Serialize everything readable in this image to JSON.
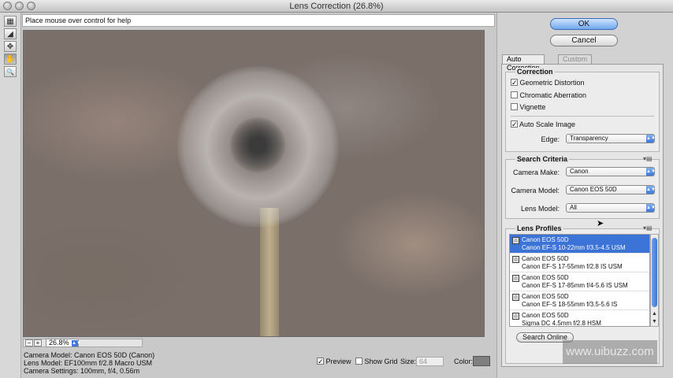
{
  "window": {
    "title": "Lens Correction (26.8%)"
  },
  "tools": [
    {
      "name": "remove-distortion-tool-icon",
      "glyph": "▦"
    },
    {
      "name": "straighten-tool-icon",
      "glyph": "◢"
    },
    {
      "name": "move-grid-tool-icon",
      "glyph": "✥"
    },
    {
      "name": "hand-tool-icon",
      "glyph": "✋"
    },
    {
      "name": "zoom-tool-icon",
      "glyph": "🔍"
    }
  ],
  "hint": "Place mouse over control for help",
  "zoom": {
    "value": "26.8%",
    "minus": "−",
    "plus": "+"
  },
  "camera_info": {
    "line1": "Camera Model: Canon EOS 50D (Canon)",
    "line2": "Lens Model: EF100mm f/2.8 Macro USM",
    "line3": "Camera Settings: 100mm, f/4, 0.56m"
  },
  "bottom": {
    "preview_label": "Preview",
    "show_grid_label": "Show Grid",
    "size_label": "Size:",
    "size_value": "64",
    "color_label": "Color:",
    "grid_color": "#7f7f7f"
  },
  "buttons": {
    "ok": "OK",
    "cancel": "Cancel"
  },
  "tabs": {
    "active": "Auto Correction",
    "inactive": "Custom"
  },
  "correction": {
    "title": "Correction",
    "geometric": "Geometric Distortion",
    "chromatic": "Chromatic Aberration",
    "vignette": "Vignette",
    "auto_scale": "Auto Scale Image",
    "edge_label": "Edge:",
    "edge_value": "Transparency"
  },
  "search": {
    "title": "Search Criteria",
    "make_label": "Camera Make:",
    "make_value": "Canon",
    "model_label": "Camera Model:",
    "model_value": "Canon EOS 50D",
    "lens_label": "Lens Model:",
    "lens_value": "All"
  },
  "profiles": {
    "title": "Lens Profiles",
    "items": [
      {
        "camera": "Canon EOS 50D",
        "lens": "Canon EF-S 10-22mm f/3.5-4.5 USM"
      },
      {
        "camera": "Canon EOS 50D",
        "lens": "Canon EF-S 17-55mm f/2.8 IS USM"
      },
      {
        "camera": "Canon EOS 50D",
        "lens": "Canon EF-S 17-85mm f/4-5.6 IS USM"
      },
      {
        "camera": "Canon EOS 50D",
        "lens": "Canon EF-S 18-55mm f/3.5-5.6 IS"
      },
      {
        "camera": "Canon EOS 50D",
        "lens": "Sigma DC 4.5mm f/2.8 HSM"
      }
    ],
    "search_online": "Search Online"
  },
  "watermark": "www.uibuzz.com",
  "colors": {
    "accent": "#3b73d6",
    "panel": "#d2d2d2"
  }
}
